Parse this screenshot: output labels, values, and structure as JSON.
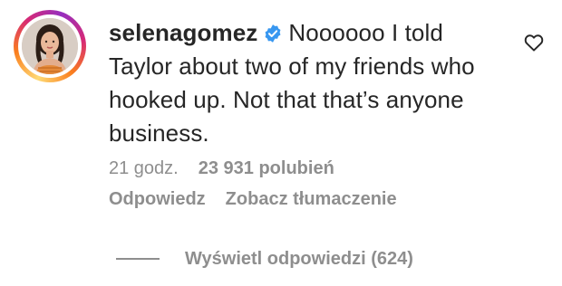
{
  "comment": {
    "username": "selenagomez",
    "verified": true,
    "text": "Noooooo I told Taylor about two of my friends who hooked up. Not that that’s anyone business.",
    "time": "21 godz.",
    "likes": "23 931 polubień",
    "reply_label": "Odpowiedz",
    "translate_label": "Zobacz tłumaczenie",
    "view_replies_label": "Wyświetl odpowiedzi (624)"
  },
  "icons": {
    "verified": "verified-badge-icon",
    "like": "heart-outline-icon"
  },
  "colors": {
    "text": "#262626",
    "secondary": "#8e8e8e",
    "verified_blue": "#3897f0"
  }
}
